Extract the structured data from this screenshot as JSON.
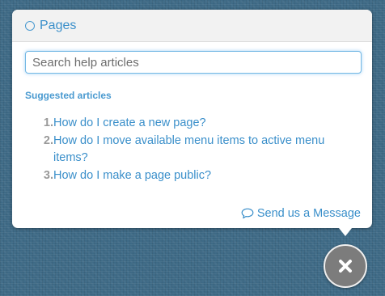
{
  "widget": {
    "title": "Pages",
    "search": {
      "placeholder": "Search help articles",
      "value": ""
    },
    "suggested_heading": "Suggested articles",
    "articles": [
      {
        "number": "1.",
        "title": "How do I create a new page?"
      },
      {
        "number": "2.",
        "title": "How do I move available menu items to active menu items?"
      },
      {
        "number": "3.",
        "title": "How do I make a page public?"
      }
    ],
    "send_message_label": "Send us a Message"
  },
  "colors": {
    "accent": "#3a8fca",
    "background": "#3e6a86",
    "close_button": "#7c7c7c"
  },
  "icons": {
    "header": "circle-icon",
    "send_message": "speech-bubble-icon",
    "close": "close-icon"
  }
}
